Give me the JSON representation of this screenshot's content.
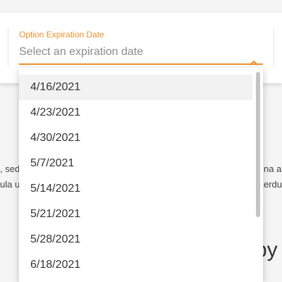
{
  "field": {
    "label": "Option Expiration Date",
    "placeholder": "Select an expiration date",
    "value": ""
  },
  "background": {
    "text_left_1": ", sed",
    "text_left_2": "ula u",
    "text_right_1": "na a",
    "text_right_2": "erdu",
    "text_big": "by"
  },
  "dropdown": {
    "options": [
      "4/16/2021",
      "4/23/2021",
      "4/30/2021",
      "5/7/2021",
      "5/14/2021",
      "5/21/2021",
      "5/28/2021",
      "6/18/2021"
    ],
    "highlighted_index": 0
  },
  "colors": {
    "accent": "#f0902e"
  }
}
